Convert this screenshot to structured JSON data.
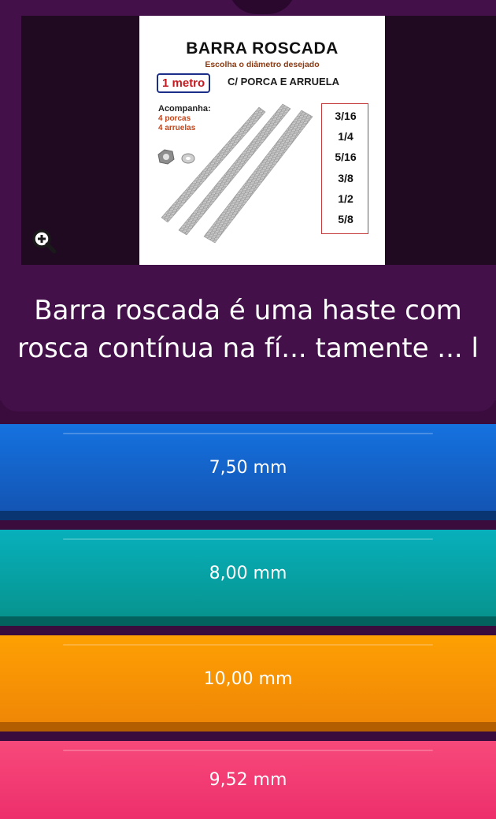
{
  "question": {
    "text": "Barra roscada é uma haste com rosca contínua na fí... tamente ... l",
    "visible_text": "Barra roscada é uma haste com rosca contínua na"
  },
  "image": {
    "title": "BARRA ROSCADA",
    "subtitle": "Escolha o diâmetro desejado",
    "length_label": "1 metro",
    "nut_washer_label": "C/ PORCA E ARRUELA",
    "accompanies_title": "Acompanha:",
    "accompanies_items": [
      "4 porcas",
      "4 arruelas"
    ],
    "diameters": [
      "3/16",
      "1/4",
      "5/16",
      "3/8",
      "1/2",
      "5/8"
    ]
  },
  "zoom_icon": "zoom-in-icon",
  "answers": [
    {
      "label": "7,50 mm",
      "color": "#1466cc"
    },
    {
      "label": "8,00 mm",
      "color": "#07a3a6"
    },
    {
      "label": "10,00 mm",
      "color": "#f89405"
    },
    {
      "label": "9,52 mm",
      "color": "#f23d73"
    }
  ],
  "colors": {
    "background": "#3a0c3e",
    "card": "#43104a"
  }
}
